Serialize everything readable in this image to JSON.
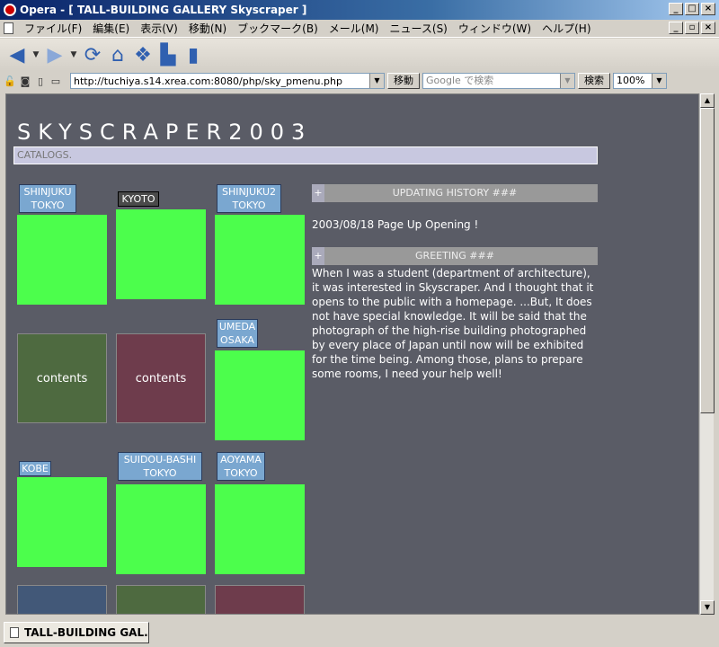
{
  "window": {
    "title": "Opera - [ TALL-BUILDING GALLERY Skyscraper ]",
    "buttons": [
      "_",
      "□",
      "×"
    ],
    "mdi_buttons": [
      "_",
      "▫",
      "×"
    ]
  },
  "menu": [
    "ファイル(F)",
    "編集(E)",
    "表示(V)",
    "移動(N)",
    "ブックマーク(B)",
    "メール(M)",
    "ニュース(S)",
    "ウィンドウ(W)",
    "ヘルプ(H)"
  ],
  "toolbar": {
    "icons": [
      "back-icon",
      "forward-icon",
      "reload-icon",
      "home-icon",
      "hotlist-icon",
      "print-icon",
      "page-icon"
    ]
  },
  "addressbar": {
    "url": "http://tuchiya.s14.xrea.com:8080/php/sky_pmenu.php",
    "go_label": "移動",
    "search_placeholder": "Google で検索",
    "search_label": "検索",
    "zoom": "100%"
  },
  "page": {
    "logo": "SKYSCRAPER2003",
    "catalog_label": "CATALOGS.",
    "tiles": [
      {
        "line1": "SHINJUKU",
        "line2": "TOKYO"
      },
      {
        "line1": "KYOTO",
        "line2": ""
      },
      {
        "line1": "SHINJUKU2",
        "line2": "TOKYO"
      },
      {
        "line1": "UMEDA",
        "line2": "OSAKA"
      },
      {
        "line1": "KOBE",
        "line2": ""
      },
      {
        "line1": "SUIDOU-BASHI",
        "line2": "TOKYO"
      },
      {
        "line1": "AOYAMA",
        "line2": "TOKYO"
      }
    ],
    "contents_label_1": "contents",
    "contents_label_2": "contents",
    "updating_header": "UPDATING HISTORY ###",
    "plus_sign": "+",
    "update_entry": "2003/08/18 Page Up Opening !",
    "greeting_header": "GREETING ###",
    "greeting_text": "When I was a student (department of architecture), it was interested in Skyscraper. And I thought that it opens to the public with a homepage. ...But, It does not have special knowledge. It will be said that the photograph of the high-rise building photographed by every place of Japan until now will be exhibited for the time being. Among those, plans to prepare some rooms, I need your help well!"
  },
  "status": {
    "tab_title": "TALL-BUILDING GAL..."
  },
  "colors": {
    "page_bg": "#5a5c66",
    "tile_green": "#4cfe4c",
    "contents_green": "#4e6a40",
    "contents_maroon": "#6e3c4c",
    "bottom_blue": "#425878"
  }
}
